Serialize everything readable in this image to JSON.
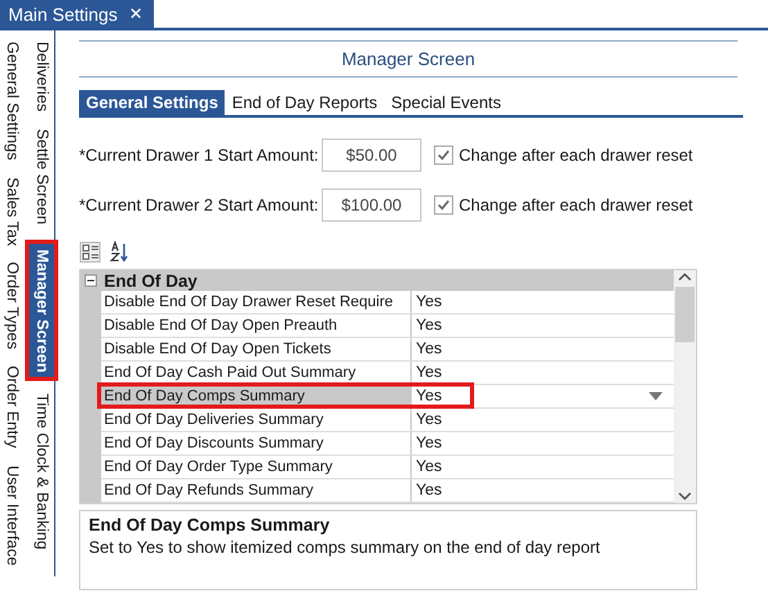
{
  "window_tab": {
    "title": "Main Settings",
    "close": "✕"
  },
  "side_tabs": [
    [
      {
        "label": "General Settings",
        "selected": false,
        "annotated": false
      },
      {
        "label": "Sales Tax",
        "selected": false,
        "annotated": false
      },
      {
        "label": "Order Types",
        "selected": false,
        "annotated": false
      },
      {
        "label": "Order Entry",
        "selected": false,
        "annotated": false
      },
      {
        "label": "User Interface",
        "selected": false,
        "annotated": false
      }
    ],
    [
      {
        "label": "Deliveries",
        "selected": false,
        "annotated": false
      },
      {
        "label": "Settle Screen",
        "selected": false,
        "annotated": false
      },
      {
        "label": "Manager Screen",
        "selected": true,
        "annotated": true
      },
      {
        "label": "Time Clock & Banking",
        "selected": false,
        "annotated": false
      }
    ]
  ],
  "page_title": "Manager Screen",
  "tabs": [
    {
      "label": "General Settings",
      "selected": true
    },
    {
      "label": "End of Day Reports",
      "selected": false
    },
    {
      "label": "Special Events",
      "selected": false
    }
  ],
  "fields": [
    {
      "label": "*Current Drawer 1 Start Amount:",
      "value": "$50.00",
      "option": "Change after each drawer reset",
      "checked": true
    },
    {
      "label": "*Current Drawer 2 Start Amount:",
      "value": "$100.00",
      "option": "Change after each drawer reset",
      "checked": true
    }
  ],
  "grid": {
    "category": "End Of Day",
    "expanded": true,
    "rows": [
      {
        "name": "Disable End Of Day Drawer Reset Require",
        "value": "Yes",
        "selected": false,
        "annotated": false
      },
      {
        "name": "Disable End Of Day Open Preauth",
        "value": "Yes",
        "selected": false,
        "annotated": false
      },
      {
        "name": "Disable End Of Day Open Tickets",
        "value": "Yes",
        "selected": false,
        "annotated": false
      },
      {
        "name": "End Of Day Cash Paid Out Summary",
        "value": "Yes",
        "selected": false,
        "annotated": false
      },
      {
        "name": "End Of Day Comps Summary",
        "value": "Yes",
        "selected": true,
        "annotated": true
      },
      {
        "name": "End Of Day Deliveries Summary",
        "value": "Yes",
        "selected": false,
        "annotated": false
      },
      {
        "name": "End Of Day Discounts Summary",
        "value": "Yes",
        "selected": false,
        "annotated": false
      },
      {
        "name": "End Of Day Order Type Summary",
        "value": "Yes",
        "selected": false,
        "annotated": false
      },
      {
        "name": "End Of Day Refunds Summary",
        "value": "Yes",
        "selected": false,
        "annotated": false
      }
    ]
  },
  "description": {
    "title": "End Of Day Comps Summary",
    "text": "Set to Yes to show itemized comps summary on the end of day report"
  }
}
